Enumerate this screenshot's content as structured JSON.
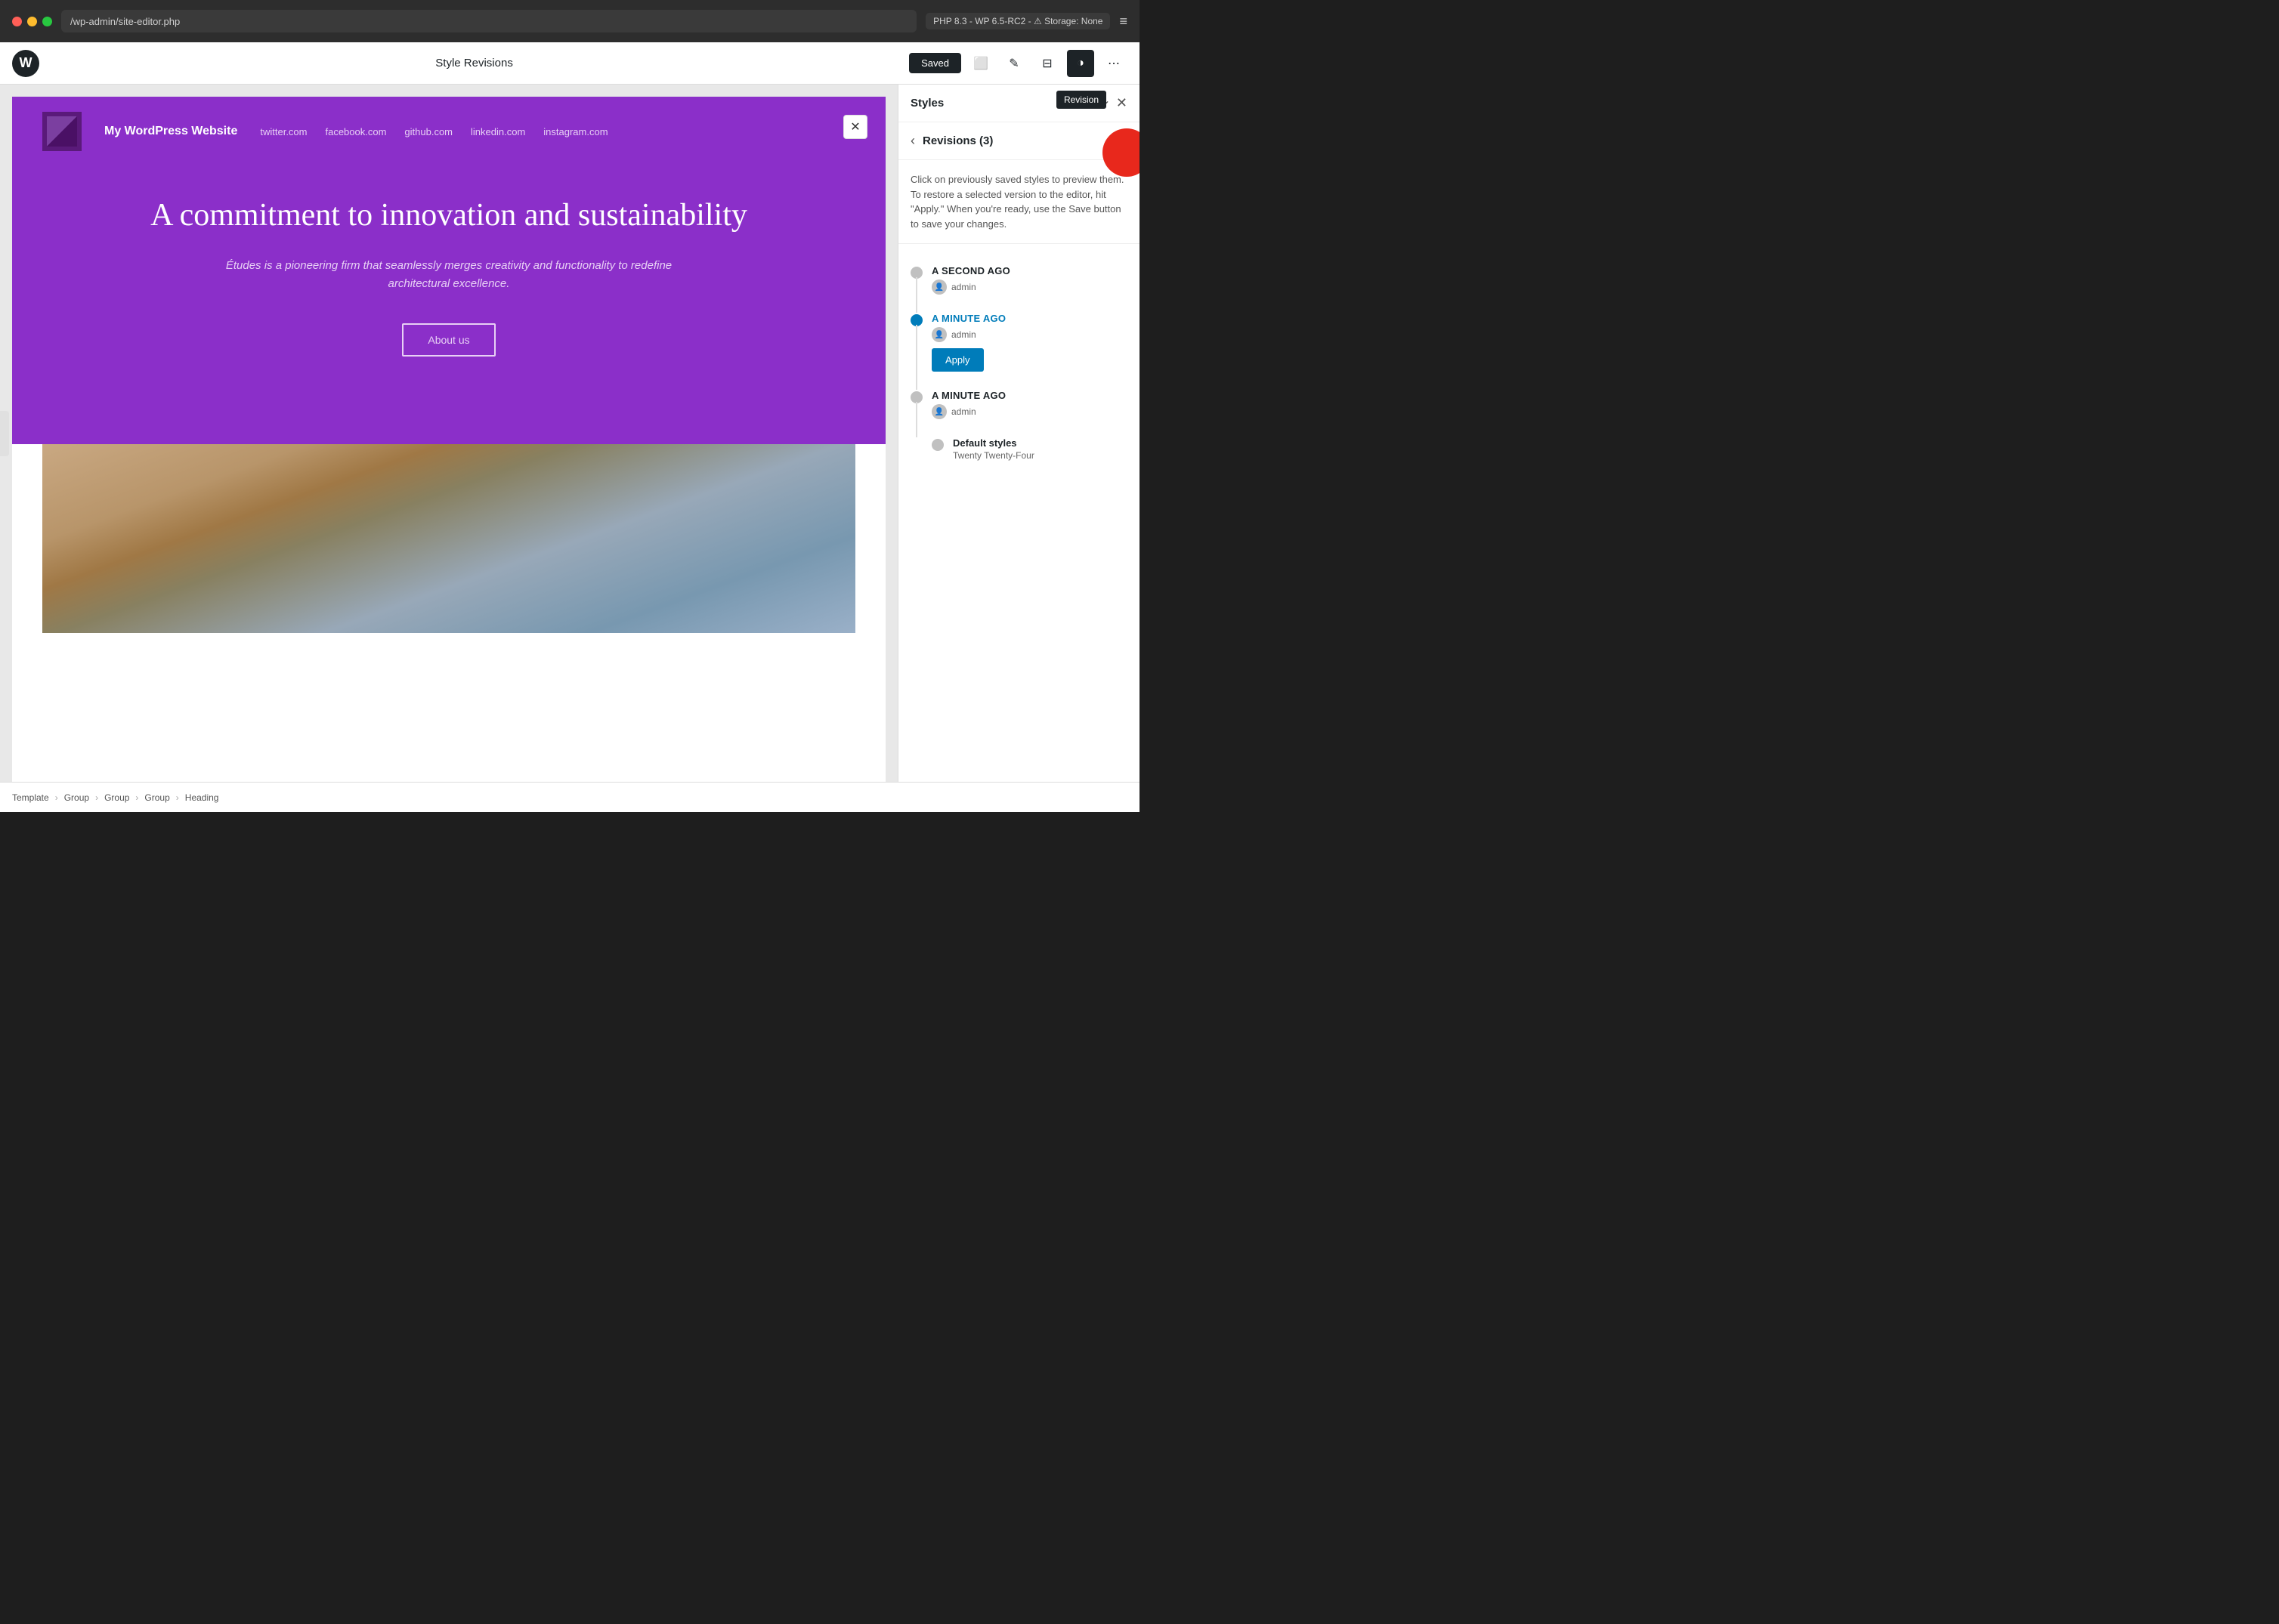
{
  "browser": {
    "url": "/wp-admin/site-editor.php",
    "php_badge": "PHP 8.3 - WP 6.5-RC2 - ⚠ Storage: None"
  },
  "toolbar": {
    "title": "Style Revisions",
    "saved_label": "Saved",
    "icons": {
      "preview": "⬜",
      "brush": "✏️",
      "layout": "⬛",
      "styles": "◑",
      "more": "⋯"
    }
  },
  "canvas": {
    "close_label": "✕",
    "nav": {
      "site_title": "My WordPress Website",
      "links": [
        "twitter.com",
        "facebook.com",
        "github.com",
        "linkedin.com",
        "instagram.com"
      ]
    },
    "hero": {
      "headline": "A commitment to innovation and sustainability",
      "subtext": "Études is a pioneering firm that seamlessly merges creativity and functionality to redefine architectural excellence.",
      "cta_label": "About us"
    }
  },
  "styles_panel": {
    "title": "Styles",
    "revisions_tooltip": "Revision"
  },
  "revisions_panel": {
    "title": "Revisions (3)",
    "back_label": "‹",
    "description": "Click on previously saved styles to preview them. To restore a selected version to the editor, hit \"Apply.\" When you're ready, use the Save button to save your changes.",
    "items": [
      {
        "id": "rev1",
        "time": "A Second Ago",
        "author": "admin",
        "active": false,
        "show_apply": false
      },
      {
        "id": "rev2",
        "time": "A Minute Ago",
        "author": "admin",
        "active": true,
        "show_apply": true,
        "apply_label": "Apply"
      },
      {
        "id": "rev3",
        "time": "A Minute Ago",
        "author": "admin",
        "active": false,
        "show_apply": false
      }
    ],
    "default_styles": {
      "label": "Default styles",
      "sublabel": "Twenty Twenty-Four"
    }
  },
  "breadcrumb": {
    "items": [
      "Template",
      "Group",
      "Group",
      "Group",
      "Heading"
    ]
  }
}
